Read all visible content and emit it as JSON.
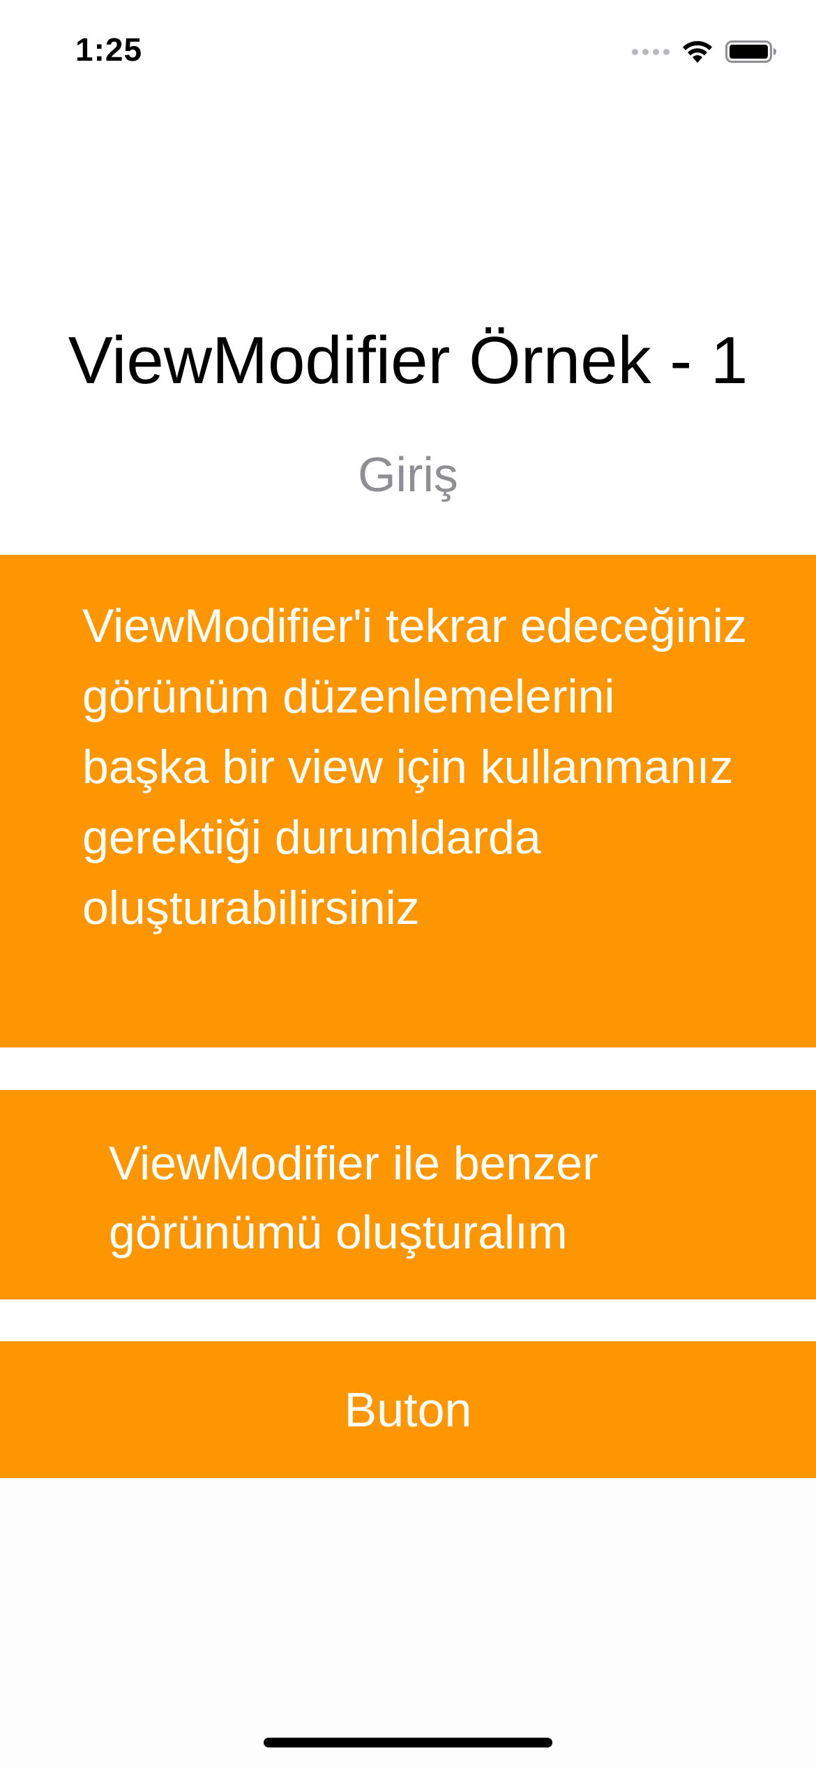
{
  "status_bar": {
    "time": "1:25",
    "icons": [
      "cellular-signal-icon",
      "wifi-icon",
      "battery-icon"
    ]
  },
  "main": {
    "title": "ViewModifier Örnek - 1",
    "subtitle": "Giriş",
    "description": "ViewModifier'i tekrar edeceğiniz görünüm düzenlemelerini başka bir view için kullanmanız gerektiği durumldarda oluşturabilirsiniz",
    "link_text": "ViewModifier ile benzer görünümü oluşturalım",
    "button_label": "Buton"
  },
  "colors": {
    "accent": "#fd9600",
    "subtitle_gray": "#8e8e93",
    "text_on_accent": "#ffffff"
  }
}
